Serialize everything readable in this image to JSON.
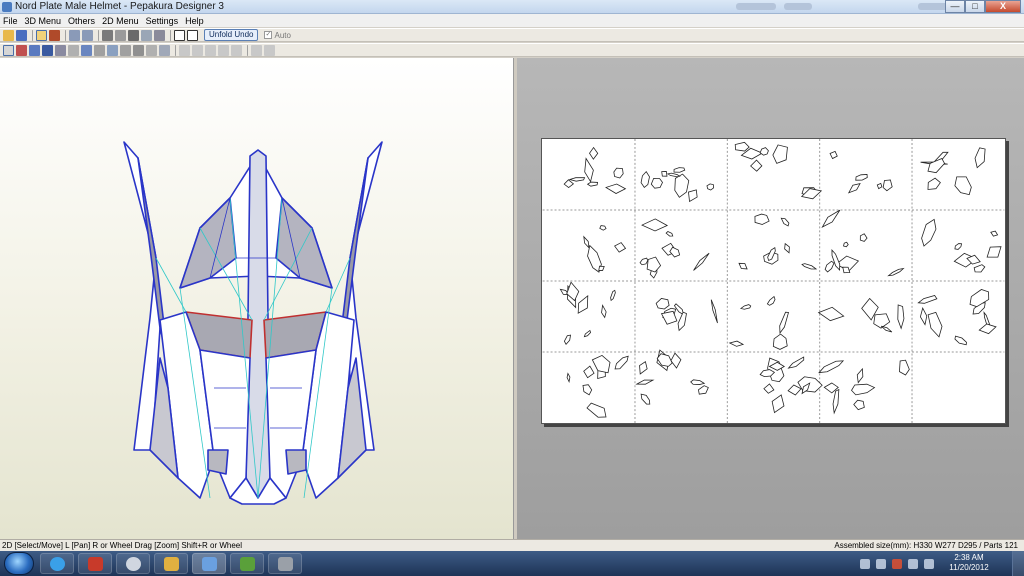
{
  "window": {
    "title": "Nord Plate Male Helmet - Pepakura Designer 3",
    "buttons": {
      "minimize": "—",
      "maximize": "□",
      "close": "X"
    }
  },
  "menubar": {
    "items": [
      "File",
      "3D Menu",
      "Others",
      "2D Menu",
      "Settings",
      "Help"
    ]
  },
  "toolbar": {
    "unfold_undo_label": "Unfold Undo",
    "auto_label": "Auto",
    "auto_checked": true
  },
  "viewport3d": {
    "model_name": "helmet-model",
    "colors": {
      "edges": "#2a35c8",
      "faces": "#ffffff",
      "shade": "#9a9aa6",
      "cut": "#c03030",
      "fold": "#30c8c8"
    }
  },
  "viewport2d": {
    "pages_cols": 5,
    "pages_rows": 4
  },
  "statusbar": {
    "left": "2D [Select/Move] L [Pan] R or Wheel Drag [Zoom] Shift+R or Wheel",
    "right": "Assembled size(mm): H330 W277 D295 / Parts 121"
  },
  "taskbar": {
    "time": "2:38 AM",
    "date": "11/20/2012",
    "apps": [
      "internet-explorer",
      "app-red",
      "wing-app",
      "folder-app",
      "pepakura",
      "green-app",
      "device-app"
    ]
  }
}
